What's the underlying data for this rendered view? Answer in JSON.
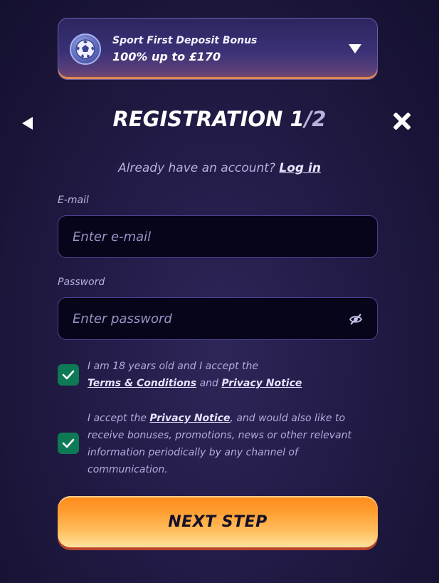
{
  "bonus": {
    "title": "Sport First Deposit Bonus",
    "amount": "100% up to £170"
  },
  "header": {
    "title_main": "REGISTRATION 1",
    "title_total": "/2"
  },
  "login": {
    "prompt": "Already have an account?",
    "link": "Log in"
  },
  "email": {
    "label": "E-mail",
    "placeholder": "Enter e-mail",
    "value": ""
  },
  "password": {
    "label": "Password",
    "placeholder": "Enter password",
    "value": ""
  },
  "consent_terms": {
    "checked": true,
    "text_before": "I am 18 years old and I accept the",
    "terms_link": "Terms & Conditions",
    "and_text": "and",
    "privacy_link": "Privacy Notice"
  },
  "consent_marketing": {
    "checked": true,
    "text_before": "I accept the",
    "privacy_link": "Privacy Notice",
    "text_after": ", and would also like to receive bonuses, promotions, news or other relevant information periodically by any channel of communication."
  },
  "next_button": {
    "label": "NEXT STEP"
  },
  "colors": {
    "accent_orange": "#ff8a1a",
    "check_green": "#0e7a55",
    "input_border": "#4a4290"
  },
  "icons": {
    "bonus": "football-icon",
    "dropdown": "chevron-down-icon",
    "back": "back-arrow-icon",
    "close": "close-icon",
    "password_toggle": "eye-off-icon",
    "checkbox": "checkmark-icon"
  }
}
